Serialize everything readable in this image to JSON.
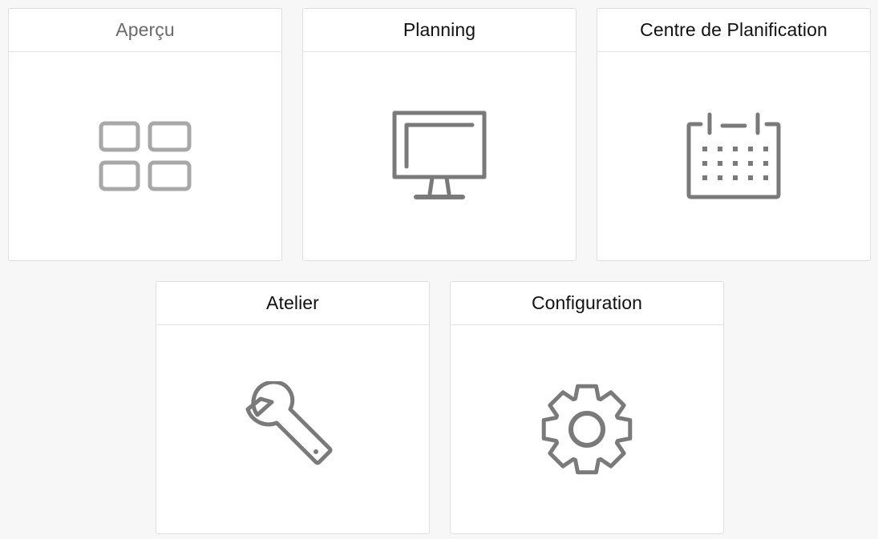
{
  "tiles": [
    {
      "id": "apercu",
      "label": "Aperçu",
      "icon": "grid-icon",
      "state": "disabled"
    },
    {
      "id": "planning",
      "label": "Planning",
      "icon": "monitor-icon",
      "state": "enabled"
    },
    {
      "id": "centre-planification",
      "label": "Centre de Planification",
      "icon": "calendar-icon",
      "state": "enabled"
    },
    {
      "id": "atelier",
      "label": "Atelier",
      "icon": "wrench-icon",
      "state": "enabled"
    },
    {
      "id": "configuration",
      "label": "Configuration",
      "icon": "gear-icon",
      "state": "enabled"
    }
  ],
  "colors": {
    "background": "#f7f7f7",
    "tile": "#ffffff",
    "border": "#dedede",
    "icon": "#7a7a7a",
    "icon_disabled": "#a8a8a8",
    "label": "#111111",
    "label_disabled": "#6a6a6a"
  }
}
